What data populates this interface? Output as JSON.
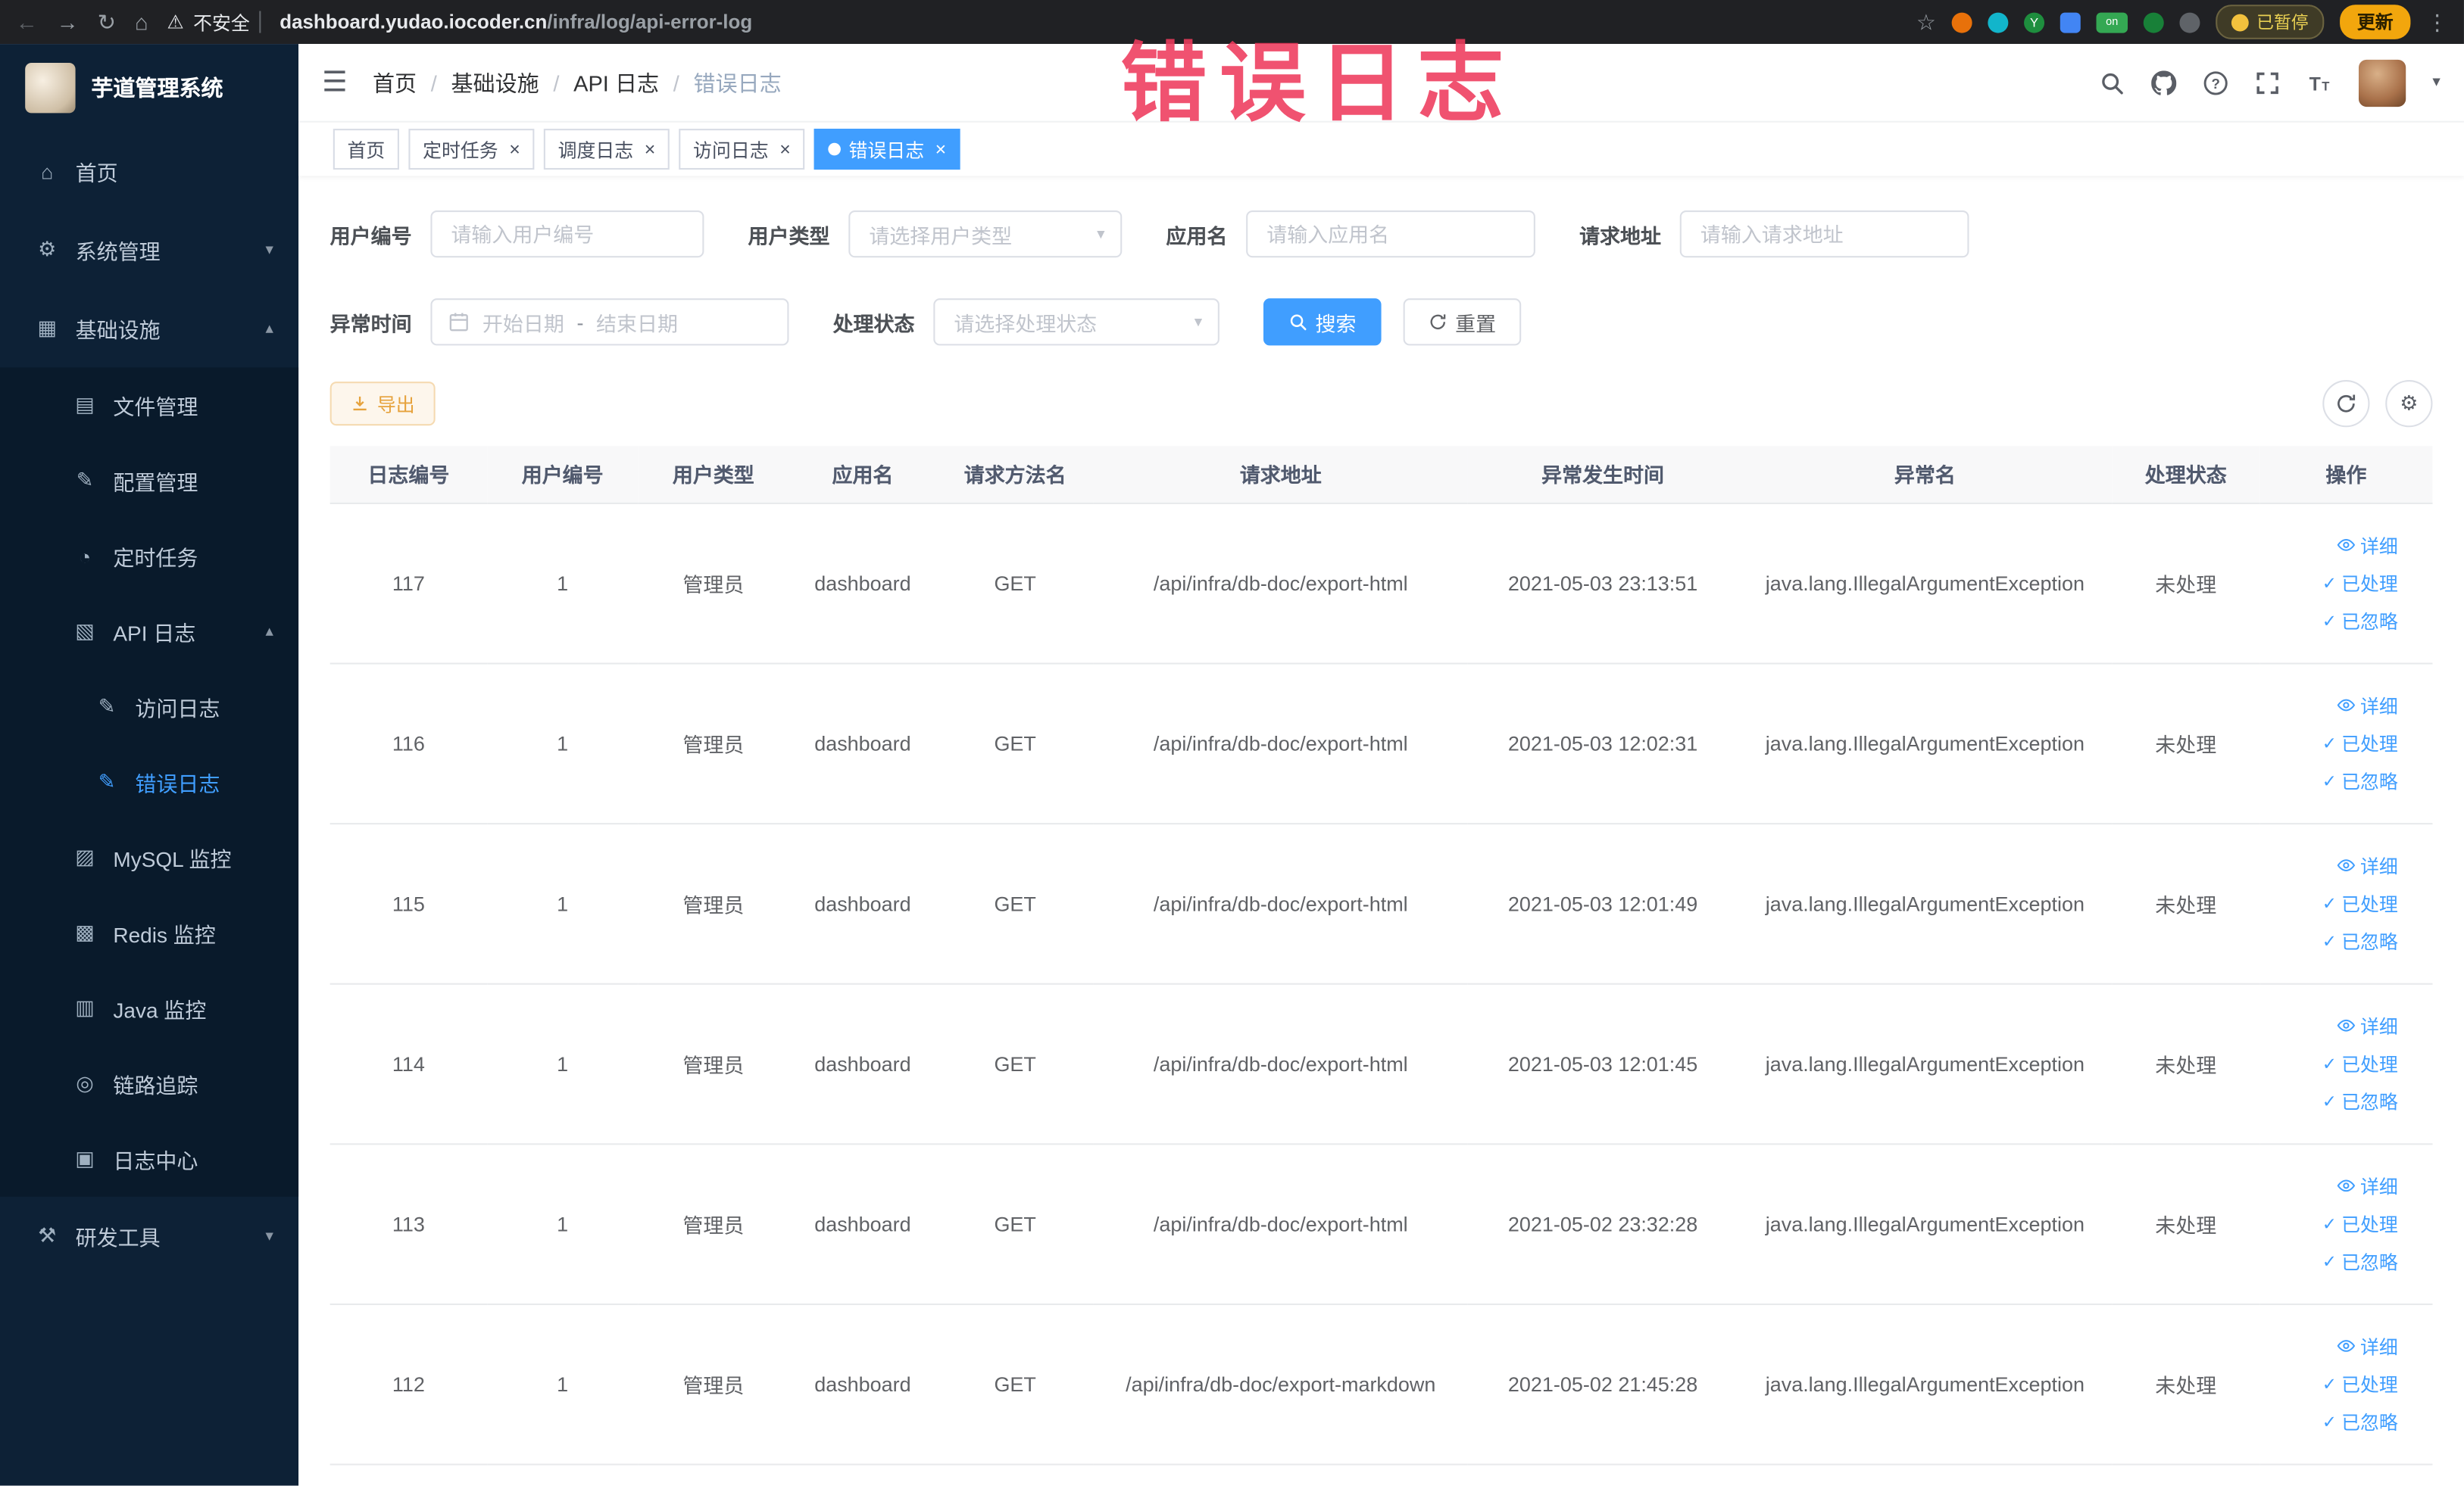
{
  "browser": {
    "security": "不安全",
    "url_domain": "dashboard.yudao.iocoder.cn",
    "url_path": "/infra/log/api-error-log",
    "ext_on": "on",
    "ext_y": "Y",
    "paused": "已暂停",
    "update": "更新"
  },
  "annotation": "错误日志",
  "icons": {
    "back": "←",
    "forward": "→",
    "reload": "↻",
    "home": "⌂",
    "warning": "⚠",
    "star": "☆",
    "dots": "⋮",
    "hamburger": "☰",
    "chev_down": "▾",
    "chev_up": "▴",
    "caret": "▾",
    "close": "×",
    "check": "✓",
    "gear": "⚙"
  },
  "sidebar": {
    "app_title": "芋道管理系统",
    "items": [
      {
        "label": "首页",
        "icon": "⌂"
      },
      {
        "label": "系统管理",
        "icon": "⚙"
      },
      {
        "label": "基础设施",
        "icon": "▦"
      },
      {
        "label": "文件管理",
        "icon": "▤"
      },
      {
        "label": "配置管理",
        "icon": "✎"
      },
      {
        "label": "定时任务",
        "icon": "◔"
      },
      {
        "label": "API 日志",
        "icon": "▧"
      },
      {
        "label": "访问日志",
        "icon": "✎"
      },
      {
        "label": "错误日志",
        "icon": "✎"
      },
      {
        "label": "MySQL 监控",
        "icon": "▨"
      },
      {
        "label": "Redis 监控",
        "icon": "▩"
      },
      {
        "label": "Java 监控",
        "icon": "▥"
      },
      {
        "label": "链路追踪",
        "icon": "◎"
      },
      {
        "label": "日志中心",
        "icon": "▣"
      },
      {
        "label": "研发工具",
        "icon": "⚒"
      }
    ]
  },
  "breadcrumb": {
    "separator": "/",
    "items": [
      "首页",
      "基础设施",
      "API 日志",
      "错误日志"
    ]
  },
  "tabs": [
    {
      "label": "首页"
    },
    {
      "label": "定时任务"
    },
    {
      "label": "调度日志"
    },
    {
      "label": "访问日志"
    },
    {
      "label": "错误日志"
    }
  ],
  "filters": {
    "user_id": {
      "label": "用户编号",
      "placeholder": "请输入用户编号"
    },
    "user_type": {
      "label": "用户类型",
      "placeholder": "请选择用户类型"
    },
    "app_name": {
      "label": "应用名",
      "placeholder": "请输入应用名"
    },
    "request_url": {
      "label": "请求地址",
      "placeholder": "请输入请求地址"
    },
    "exception_time": {
      "label": "异常时间",
      "start": "开始日期",
      "separator": "-",
      "end": "结束日期"
    },
    "process_status": {
      "label": "处理状态",
      "placeholder": "请选择处理状态"
    },
    "search": "搜索",
    "reset": "重置"
  },
  "toolbar": {
    "export": "导出"
  },
  "table": {
    "columns": [
      "日志编号",
      "用户编号",
      "用户类型",
      "应用名",
      "请求方法名",
      "请求地址",
      "异常发生时间",
      "异常名",
      "处理状态",
      "操作"
    ],
    "actions": {
      "detail": "详细",
      "process": "已处理",
      "ignore": "已忽略"
    },
    "rows": [
      {
        "id": "117",
        "user_id": "1",
        "user_type": "管理员",
        "app_name": "dashboard",
        "method": "GET",
        "url": "/api/infra/db-doc/export-html",
        "time": "2021-05-03 23:13:51",
        "exception": "java.lang.IllegalArgumentException",
        "status": "未处理"
      },
      {
        "id": "116",
        "user_id": "1",
        "user_type": "管理员",
        "app_name": "dashboard",
        "method": "GET",
        "url": "/api/infra/db-doc/export-html",
        "time": "2021-05-03 12:02:31",
        "exception": "java.lang.IllegalArgumentException",
        "status": "未处理"
      },
      {
        "id": "115",
        "user_id": "1",
        "user_type": "管理员",
        "app_name": "dashboard",
        "method": "GET",
        "url": "/api/infra/db-doc/export-html",
        "time": "2021-05-03 12:01:49",
        "exception": "java.lang.IllegalArgumentException",
        "status": "未处理"
      },
      {
        "id": "114",
        "user_id": "1",
        "user_type": "管理员",
        "app_name": "dashboard",
        "method": "GET",
        "url": "/api/infra/db-doc/export-html",
        "time": "2021-05-03 12:01:45",
        "exception": "java.lang.IllegalArgumentException",
        "status": "未处理"
      },
      {
        "id": "113",
        "user_id": "1",
        "user_type": "管理员",
        "app_name": "dashboard",
        "method": "GET",
        "url": "/api/infra/db-doc/export-html",
        "time": "2021-05-02 23:32:28",
        "exception": "java.lang.IllegalArgumentException",
        "status": "未处理"
      },
      {
        "id": "112",
        "user_id": "1",
        "user_type": "管理员",
        "app_name": "dashboard",
        "method": "GET",
        "url": "/api/infra/db-doc/export-markdown",
        "time": "2021-05-02 21:45:28",
        "exception": "java.lang.IllegalArgumentException",
        "status": "未处理"
      }
    ]
  },
  "colors": {
    "primary": "#409EFF",
    "warning": "#e6a23c",
    "sidebar_bg": "#0d2136",
    "annotation": "#ee3a5c"
  }
}
